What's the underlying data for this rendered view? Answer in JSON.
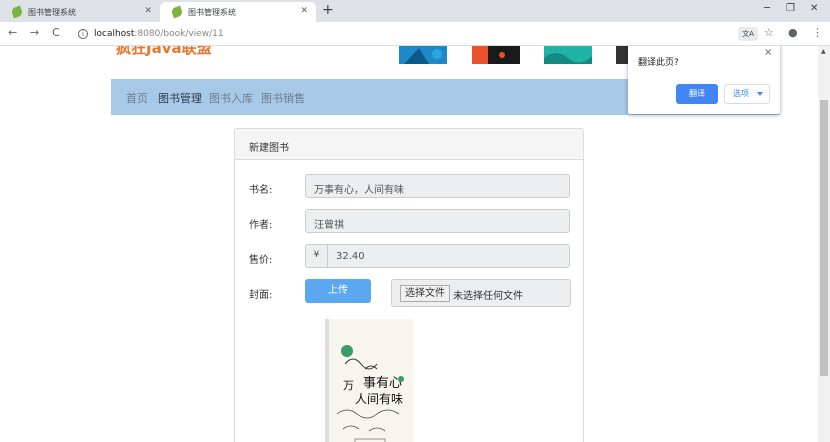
{
  "browser": {
    "tabs": [
      {
        "title": "图书管理系统",
        "close": "✕"
      },
      {
        "title": "图书管理系统",
        "close": "✕"
      }
    ],
    "new_tab": "+",
    "window_controls": {
      "minimize": "─",
      "maximize": "❐",
      "close": "✕"
    },
    "nav": {
      "back": "←",
      "forward": "→",
      "reload": "C"
    },
    "url_host": "localhost",
    "url_path": ":8080/book/view/11",
    "translate_chip": "文A",
    "toolbar_icons": {
      "star": "☆",
      "profile": "●",
      "menu": "⋮"
    }
  },
  "site": {
    "logo": "疯狂Java联盟",
    "nav": [
      "首页",
      "图书管理",
      "图书入库",
      "图书销售"
    ],
    "active_nav": "图书管理"
  },
  "form": {
    "panel_title": "新建图书",
    "title_label": "书名:",
    "title_value": "万事有心，人间有味",
    "author_label": "作者:",
    "author_value": "汪曾祺",
    "price_label": "售价:",
    "price_addon": "¥",
    "price_value": "32.40",
    "cover_label": "封面:",
    "upload_label": "上传",
    "file_choose_label": "选择文件",
    "file_none_text": "未选择任何文件"
  },
  "translate_popup": {
    "title": "翻译此页?",
    "close": "×",
    "translate_button": "翻译",
    "options_button": "选项"
  },
  "colors": {
    "navbar": "#a8c8e8",
    "upload_button": "#5ba8f0",
    "translate_button": "#4285f4",
    "logo": "#e8772e"
  }
}
